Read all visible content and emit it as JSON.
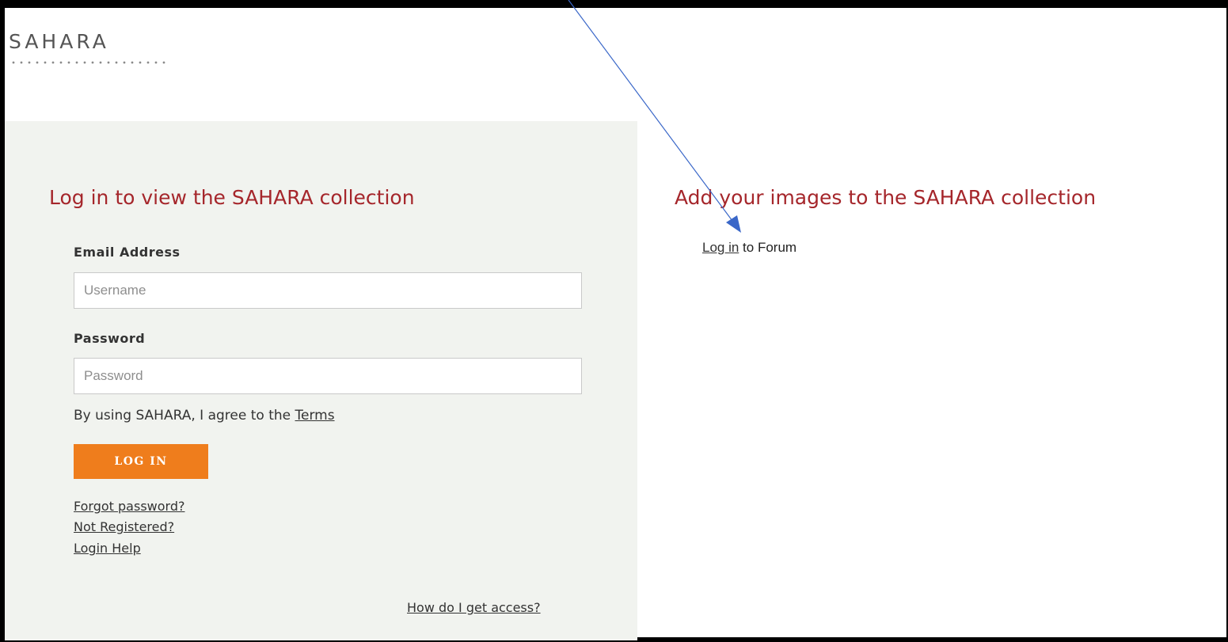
{
  "logo": {
    "text": "SAHARA"
  },
  "left_panel": {
    "heading": "Log in to view the SAHARA collection",
    "email": {
      "label": "Email Address",
      "placeholder": "Username",
      "value": ""
    },
    "password": {
      "label": "Password",
      "placeholder": "Password",
      "value": ""
    },
    "agree_prefix": "By using SAHARA, I agree to the ",
    "terms_label": "Terms",
    "login_button": "LOG IN",
    "forgot_password": "Forgot password?",
    "not_registered": "Not Registered?",
    "login_help": "Login Help",
    "access_link": "How do I get access?"
  },
  "right_panel": {
    "heading": "Add your images to the SAHARA collection",
    "forum_link": "Log in",
    "forum_suffix": " to Forum"
  },
  "colors": {
    "heading": "#a5262b",
    "button": "#ef7d1c",
    "panel_bg": "#f1f3ef",
    "annotation_arrow": "#3a67c8"
  }
}
